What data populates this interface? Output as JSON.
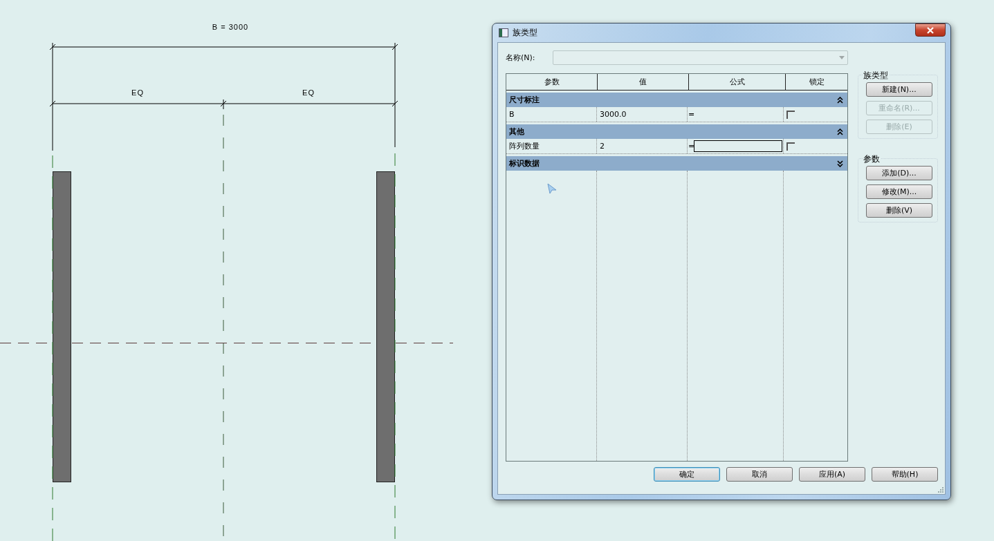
{
  "drawing": {
    "overall_dimension": "B = 3000",
    "segment_dimensions": [
      "EQ",
      "EQ"
    ]
  },
  "dialog": {
    "title": "族类型",
    "name_label": "名称(N):",
    "columns": [
      "参数",
      "值",
      "公式",
      "锁定"
    ],
    "groups": [
      {
        "name": "尺寸标注",
        "expanded": true,
        "rows": [
          {
            "parameter": "B",
            "value": "3000.0",
            "formula": "=",
            "editing": false,
            "locked": false
          }
        ]
      },
      {
        "name": "其他",
        "expanded": true,
        "rows": [
          {
            "parameter": "阵列数量",
            "value": "2",
            "formula": "=",
            "editing": true,
            "locked": false
          }
        ]
      },
      {
        "name": "标识数据",
        "expanded": false
      }
    ],
    "side_groups": [
      {
        "title": "族类型",
        "buttons": [
          {
            "label": "新建(N)...",
            "disabled": false
          },
          {
            "label": "重命名(R)...",
            "disabled": true
          },
          {
            "label": "删除(E)",
            "disabled": true
          }
        ]
      },
      {
        "title": "参数",
        "buttons": [
          {
            "label": "添加(D)...",
            "disabled": false
          },
          {
            "label": "修改(M)...",
            "disabled": false
          },
          {
            "label": "删除(V)",
            "disabled": false
          }
        ]
      }
    ],
    "footer_buttons": [
      {
        "label": "确定",
        "default": true
      },
      {
        "label": "取消",
        "default": false
      },
      {
        "label": "应用(A)",
        "default": false
      },
      {
        "label": "帮助(H)",
        "default": false
      }
    ]
  }
}
